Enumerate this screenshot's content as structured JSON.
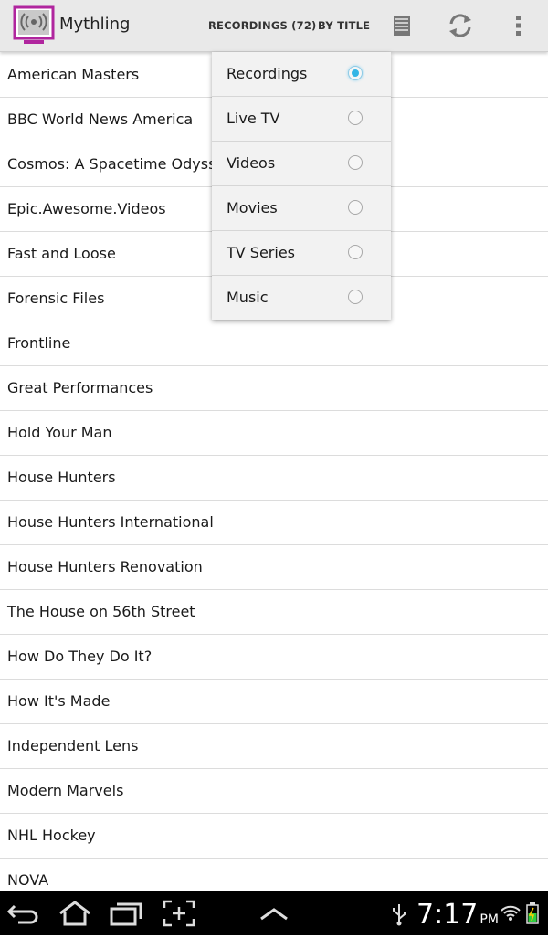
{
  "app": {
    "title": "Mythling",
    "icon": "tv-broadcast-icon",
    "accent": "#b0259e"
  },
  "actionbar": {
    "recordings_tab": "RECORDINGS (72)",
    "sort_tab": "BY TITLE",
    "icons": [
      "list-view-icon",
      "refresh-icon",
      "overflow-menu-icon"
    ]
  },
  "list": {
    "items": [
      "American Masters",
      "BBC World News America",
      "Cosmos: A Spacetime Odyssey",
      "Epic.Awesome.Videos",
      "Fast and Loose",
      "Forensic Files",
      "Frontline",
      "Great Performances",
      "Hold Your Man",
      "House Hunters",
      "House Hunters International",
      "House Hunters Renovation",
      "The House on 56th Street",
      "How Do They Do It?",
      "How It's Made",
      "Independent Lens",
      "Modern Marvels",
      "NHL Hockey",
      "NOVA"
    ]
  },
  "dropdown": {
    "selected_color": "#33b5e5",
    "options": [
      {
        "label": "Recordings",
        "selected": true
      },
      {
        "label": "Live TV",
        "selected": false
      },
      {
        "label": "Videos",
        "selected": false
      },
      {
        "label": "Movies",
        "selected": false
      },
      {
        "label": "TV Series",
        "selected": false
      },
      {
        "label": "Music",
        "selected": false
      }
    ]
  },
  "statusbar": {
    "time": "7:17",
    "ampm": "PM",
    "icons": [
      "back-icon",
      "home-icon",
      "recent-apps-icon",
      "screenshot-icon",
      "expand-up-icon",
      "usb-icon",
      "wifi-icon",
      "battery-icon"
    ]
  }
}
